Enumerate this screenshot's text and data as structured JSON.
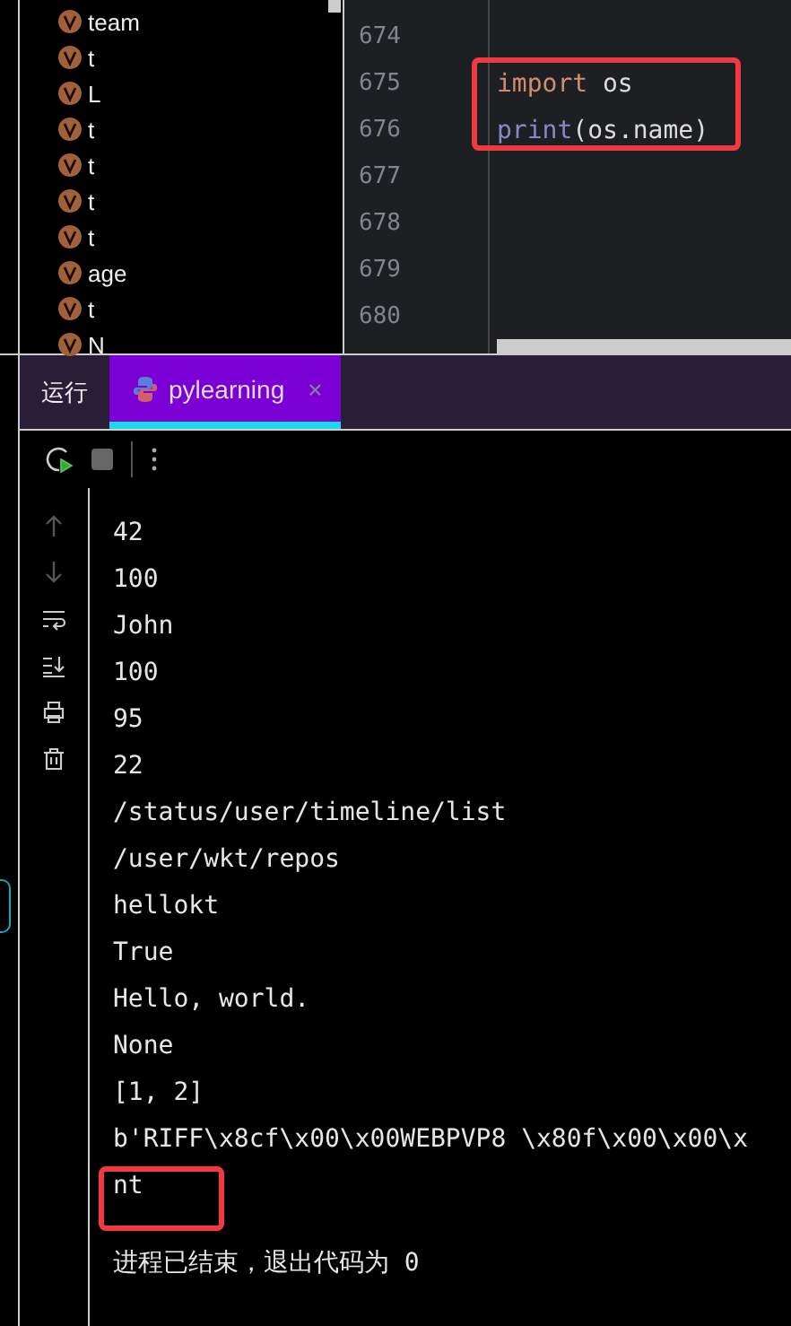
{
  "structure": {
    "items": [
      {
        "label": "team"
      },
      {
        "label": "t"
      },
      {
        "label": "L"
      },
      {
        "label": "t"
      },
      {
        "label": "t"
      },
      {
        "label": "t"
      },
      {
        "label": "t"
      },
      {
        "label": "age"
      },
      {
        "label": "t"
      },
      {
        "label": "N"
      }
    ]
  },
  "editor": {
    "lines": [
      {
        "number": "674",
        "boxed": false
      },
      {
        "number": "675",
        "boxed": true,
        "tokens": [
          {
            "text": "import",
            "kind": "keyword"
          },
          {
            "text": " os",
            "kind": "plain"
          }
        ]
      },
      {
        "number": "676",
        "boxed": true,
        "tokens": [
          {
            "text": "print",
            "kind": "builtin"
          },
          {
            "text": "(os.name)",
            "kind": "plain"
          }
        ]
      },
      {
        "number": "677",
        "boxed": false
      },
      {
        "number": "678",
        "boxed": false
      },
      {
        "number": "679",
        "boxed": false
      },
      {
        "number": "680",
        "boxed": false
      }
    ]
  },
  "run_panel": {
    "title": "运行",
    "tabs": [
      {
        "label": "pylearning",
        "selected": true,
        "close": "×"
      }
    ]
  },
  "console": {
    "lines": [
      {
        "text": "42",
        "boxed": false
      },
      {
        "text": "100",
        "boxed": false
      },
      {
        "text": "John",
        "boxed": false
      },
      {
        "text": "100",
        "boxed": false
      },
      {
        "text": "95",
        "boxed": false
      },
      {
        "text": "22",
        "boxed": false
      },
      {
        "text": "/status/user/timeline/list",
        "boxed": false
      },
      {
        "text": "/user/wkt/repos",
        "boxed": false
      },
      {
        "text": "hellokt",
        "boxed": false
      },
      {
        "text": "True",
        "boxed": false
      },
      {
        "text": "Hello, world.",
        "boxed": false
      },
      {
        "text": "None",
        "boxed": false
      },
      {
        "text": "[1, 2]",
        "boxed": false
      },
      {
        "text": "b'RIFF\\x8cf\\x00\\x00WEBPVP8 \\x80f\\x00\\x00\\x",
        "boxed": false
      },
      {
        "text": "nt",
        "boxed": true
      }
    ],
    "exit_message": "进程已结束，退出代码为 0"
  }
}
